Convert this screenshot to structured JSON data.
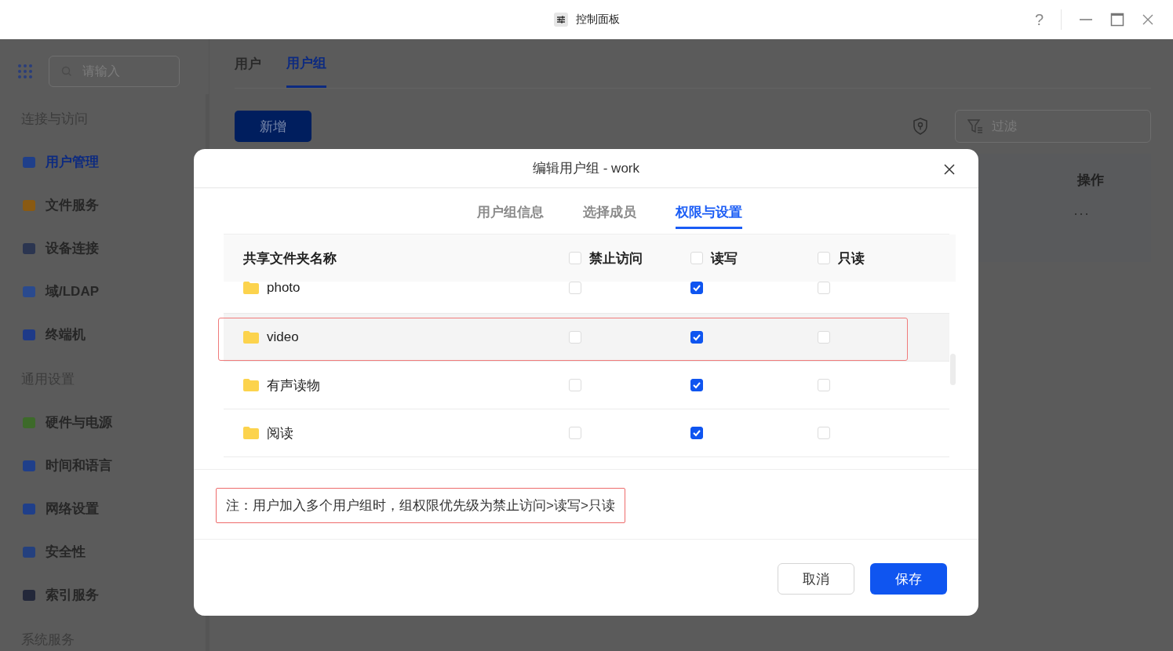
{
  "window": {
    "title": "控制面板",
    "help": "?"
  },
  "sidebar": {
    "search_placeholder": "请输入",
    "groups": [
      {
        "title": "连接与访问",
        "items": [
          {
            "label": "用户管理",
            "selected": true
          },
          {
            "label": "文件服务",
            "selected": false
          },
          {
            "label": "设备连接",
            "selected": false
          },
          {
            "label": "域/LDAP",
            "selected": false
          },
          {
            "label": "终端机",
            "selected": false
          }
        ]
      },
      {
        "title": "通用设置",
        "items": [
          {
            "label": "硬件与电源",
            "selected": false
          },
          {
            "label": "时间和语言",
            "selected": false
          },
          {
            "label": "网络设置",
            "selected": false
          },
          {
            "label": "安全性",
            "selected": false
          },
          {
            "label": "索引服务",
            "selected": false
          }
        ]
      },
      {
        "title": "系统服务"
      }
    ]
  },
  "main": {
    "tabs": [
      {
        "label": "用户",
        "selected": false
      },
      {
        "label": "用户组",
        "selected": true
      }
    ],
    "add_button": "新增",
    "filter_placeholder": "过滤",
    "table": {
      "columns": [
        "操作"
      ],
      "rows": [
        {
          "action": "···"
        }
      ]
    }
  },
  "dialog": {
    "title": "编辑用户组 - work",
    "tabs": [
      {
        "label": "用户组信息",
        "selected": false
      },
      {
        "label": "选择成员",
        "selected": false
      },
      {
        "label": "权限与设置",
        "selected": true
      }
    ],
    "table": {
      "name_column": "共享文件夹名称",
      "check_columns": [
        {
          "label": "禁止访问",
          "checked": false
        },
        {
          "label": "读写",
          "checked": false
        },
        {
          "label": "只读",
          "checked": false
        }
      ],
      "rows": [
        {
          "name": "photo",
          "checks": [
            false,
            true,
            false
          ],
          "highlighted": false
        },
        {
          "name": "video",
          "checks": [
            false,
            true,
            false
          ],
          "highlighted": true
        },
        {
          "name": "有声读物",
          "checks": [
            false,
            true,
            false
          ],
          "highlighted": false
        },
        {
          "name": "阅读",
          "checks": [
            false,
            true,
            false
          ],
          "highlighted": false
        }
      ]
    },
    "note": {
      "text": "注：用户加入多个用户组时，组权限优先级为禁止访问>读写>只读",
      "highlighted": true
    },
    "buttons": [
      {
        "label": "取消",
        "kind": "secondary"
      },
      {
        "label": "保存",
        "kind": "primary"
      }
    ]
  }
}
